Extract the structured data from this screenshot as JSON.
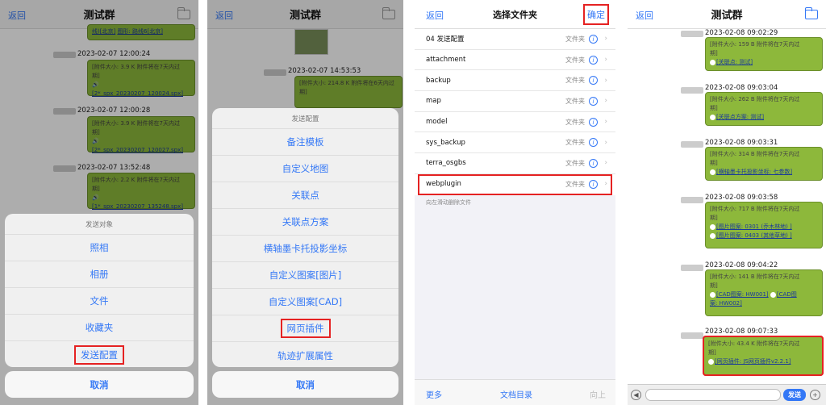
{
  "p1": {
    "nav": {
      "back": "返回",
      "title": "测试群"
    },
    "top_bubble": {
      "left": "线)[北京]",
      "right": "图形: 路线6[北京]"
    },
    "messages": [
      {
        "time": "2023-02-07 12:00:24",
        "line1": "[附件大小: 3.9 K 附件将在7天内过",
        "line2": "期]",
        "link": "[2*_spx_20230207_120024.spx]"
      },
      {
        "time": "2023-02-07 12:00:28",
        "line1": "[附件大小: 3.9 K 附件将在7天内过",
        "line2": "期]",
        "link": "[2*_spx_20230207_120027.spx]"
      },
      {
        "time": "2023-02-07 13:52:48",
        "line1": "[附件大小: 2.2 K 附件将在7天内过",
        "line2": "期]",
        "link": "[1*_spx_20230207_135248.spx]"
      }
    ],
    "sheet": {
      "title": "发送对象",
      "items": [
        "照相",
        "相册",
        "文件",
        "收藏夹",
        "发送配置"
      ],
      "cancel": "取消"
    }
  },
  "p2": {
    "nav": {
      "back": "返回",
      "title": "测试群"
    },
    "time": "2023-02-07 14:53:53",
    "bubble": {
      "line1": "[附件大小: 214.8 K 附件将在6天内过",
      "line2": "期]"
    },
    "sheet": {
      "title": "发送配置",
      "items": [
        "备注模板",
        "自定义地图",
        "关联点",
        "关联点方案",
        "横轴墨卡托投影坐标",
        "自定义图案[图片]",
        "自定义图案[CAD]",
        "网页插件",
        "轨迹扩展属性"
      ],
      "cancel": "取消"
    }
  },
  "p3": {
    "nav": {
      "back": "返回",
      "title": "选择文件夹",
      "confirm": "确定"
    },
    "rows": [
      {
        "name": "04 发送配置",
        "kind": "文件夹"
      },
      {
        "name": "attachment",
        "kind": "文件夹"
      },
      {
        "name": "backup",
        "kind": "文件夹"
      },
      {
        "name": "map",
        "kind": "文件夹"
      },
      {
        "name": "model",
        "kind": "文件夹"
      },
      {
        "name": "sys_backup",
        "kind": "文件夹"
      },
      {
        "name": "terra_osgbs",
        "kind": "文件夹"
      },
      {
        "name": "webplugin",
        "kind": "文件夹"
      }
    ],
    "hint": "向左滑动删除文件",
    "bottom": {
      "more": "更多",
      "dir": "文档目录",
      "up": "向上"
    }
  },
  "p4": {
    "nav": {
      "back": "返回",
      "title": "测试群"
    },
    "messages": [
      {
        "time": "2023-02-08 09:02:29",
        "line1": "[附件大小: 159 B 附件将在7天内过",
        "line2": "期]",
        "links": [
          "[关联点: 测试]"
        ]
      },
      {
        "time": "2023-02-08 09:03:04",
        "line1": "[附件大小: 262 B 附件将在7天内过",
        "line2": "期]",
        "links": [
          "[关联点方案: 测试]"
        ]
      },
      {
        "time": "2023-02-08 09:03:31",
        "line1": "[附件大小: 314 B 附件将在7天内过",
        "line2": "期]",
        "links": [
          "[横轴墨卡托投影坐标: 七参数]"
        ]
      },
      {
        "time": "2023-02-08 09:03:58",
        "line1": "[附件大小: 717 B 附件将在7天内过",
        "line2": "期]",
        "links": [
          "[图片图案: 0301 (乔木林地) ]",
          "[图片图案: 0403 (其他草地) ]"
        ]
      },
      {
        "time": "2023-02-08 09:04:22",
        "line1": "[附件大小: 141 B 附件将在7天内过",
        "line2": "期]",
        "links": [
          "[CAD图案: HW001]",
          "[CAD图",
          "案: HW002]"
        ]
      },
      {
        "time": "2023-02-08 09:07:33",
        "line1": "[附件大小: 43.4 K 附件将在7天内过",
        "line2": "期]",
        "links": [
          "[网页插件: JS网页插件v2.2.1]"
        ]
      }
    ],
    "input": {
      "send": "发送",
      "plus": "+",
      "left": "◀"
    }
  },
  "colors": {
    "accent": "#3478f6",
    "bubble": "#8db83b",
    "highlight": "#e52222"
  }
}
